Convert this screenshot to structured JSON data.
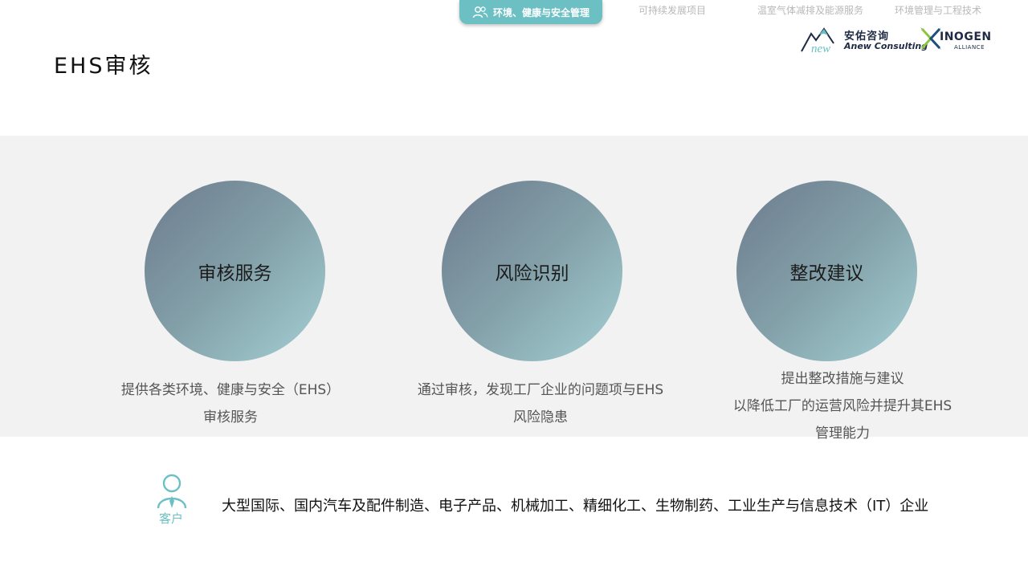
{
  "nav": {
    "active": "环境、健康与安全管理",
    "items": [
      "可持续发展项目",
      "温室气体减排及能源服务",
      "环境管理与工程技术"
    ],
    "accent": "#6cc0c4"
  },
  "title": "EHS审核",
  "logos": {
    "anew_cn": "安佑咨询",
    "anew_en": "Anew Consulting",
    "anew_mark": "new",
    "inogen_name": "INOGEN",
    "inogen_sub": "ALLIANCE"
  },
  "cards": [
    {
      "title": "审核服务",
      "desc": [
        "提供各类环境、健康与安全（EHS）",
        "审核服务"
      ]
    },
    {
      "title": "风险识别",
      "desc": [
        "通过审核，发现工厂企业的问题项与EHS",
        "风险隐患"
      ]
    },
    {
      "title": "整改建议",
      "desc": [
        "提出整改措施与建议",
        "以降低工厂的运营风险并提升其EHS",
        "管理能力"
      ]
    }
  ],
  "customer": {
    "label": "客户",
    "text": "大型国际、国内汽车及配件制造、电子产品、机械加工、精细化工、生物制药、工业生产与信息技术（IT）企业"
  }
}
